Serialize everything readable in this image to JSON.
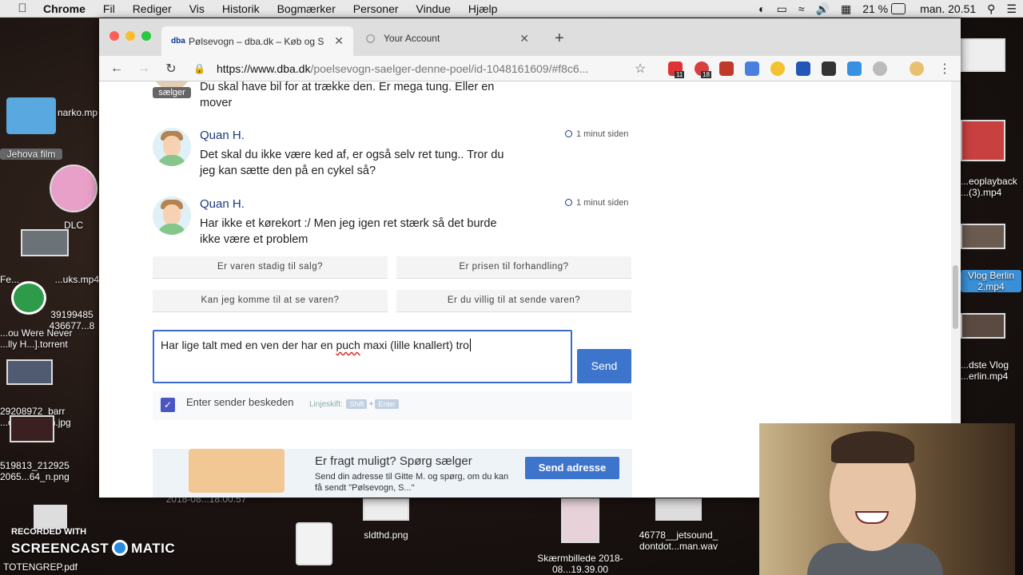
{
  "menubar": {
    "app": "Chrome",
    "items": [
      "Fil",
      "Rediger",
      "Vis",
      "Historik",
      "Bogmærker",
      "Personer",
      "Vindue",
      "Hjælp"
    ],
    "battery": "21 %",
    "clock": "man. 20.51"
  },
  "browser": {
    "tabs": [
      {
        "favicon": "dba",
        "title": "Pølsevogn – dba.dk – Køb og S",
        "active": true
      },
      {
        "favicon": "globe",
        "title": "Your Account",
        "active": false
      }
    ],
    "url_host": "https://www.dba.dk",
    "url_path": "/poelsevogn-saelger-denne-poel/id-1048161609/#f8c6...",
    "ext_badges": [
      "11",
      "18"
    ]
  },
  "chat": {
    "seller_badge": "sælger",
    "seller_message": "Du skal have bil for at trække den. Er mega tung. Eller en mover",
    "messages": [
      {
        "name": "Quan H.",
        "time": "1 minut siden",
        "text": "Det skal du ikke være ked af, er også selv ret tung.. Tror du jeg kan sætte den på en cykel så?"
      },
      {
        "name": "Quan H.",
        "time": "1 minut siden",
        "text": "Har ikke et kørekort :/ Men jeg igen ret stærk så det burde ikke være et problem"
      }
    ],
    "quick_replies": [
      "Er varen stadig til salg?",
      "Er prisen til forhandling?",
      "Kan jeg komme til at se varen?",
      "Er du villig til at sende varen?"
    ],
    "compose_before": "Har lige talt med en ven der har en ",
    "compose_misspelled": "puch",
    "compose_after": " maxi (lille knallert) tro",
    "send_label": "Send",
    "enter_sends_label": "Enter sender beskeden",
    "enter_sends_checked": true,
    "linebreak_hint": "Linjeskift:",
    "key_shift": "Shift",
    "key_plus": "+",
    "key_enter": "Enter"
  },
  "promo": {
    "title": "Er fragt muligt? Spørg sælger",
    "subtitle": "Send din adresse til Gitte M. og spørg, om du kan få sendt \"Pølsevogn, S...\"",
    "button": "Send adresse"
  },
  "desktop": {
    "icons": [
      "narko.mp",
      "Jehova film",
      "DLC",
      "Fe...",
      "...uks.mp4",
      "39199485 436677...8",
      "...ou Were Never ...lly H...].torrent",
      "29208972_barr ...oba...satan.jpg",
      "519813_212925 2065...64_n.png",
      "2018-08...18.00.57",
      "sldthd.png",
      "Skærmbillede 2018-08...19.39.00",
      "46778__jetsound_ dontdot...man.wav",
      "TOTENGREP.pdf",
      "...eoplayback ...(3).mp4",
      "Vlog Berlin 2.mp4",
      "...dste Vlog ...erlin.mp4"
    ]
  },
  "watermark": {
    "line1": "RECORDED WITH",
    "line2a": "SCREENCAST",
    "line2b": "MATIC"
  }
}
